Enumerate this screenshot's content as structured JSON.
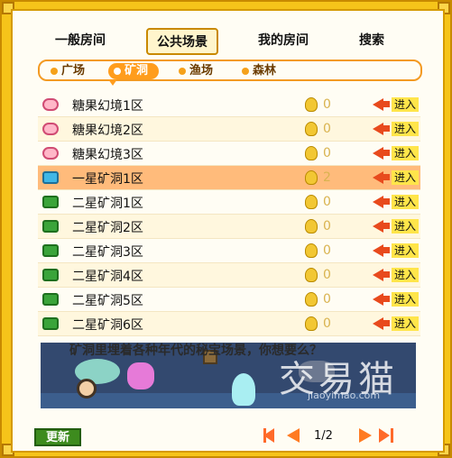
{
  "tabs": [
    {
      "label": "一般房间"
    },
    {
      "label": "公共场景",
      "active": true
    },
    {
      "label": "我的房间"
    },
    {
      "label": "搜索"
    }
  ],
  "subtabs": [
    {
      "label": "广场"
    },
    {
      "label": "矿洞",
      "active": true
    },
    {
      "label": "渔场"
    },
    {
      "label": "森林"
    }
  ],
  "rooms": [
    {
      "icon": "candy-icon",
      "name": "糖果幻境1区",
      "count": "0"
    },
    {
      "icon": "candy-icon",
      "name": "糖果幻境2区",
      "count": "0"
    },
    {
      "icon": "candy-icon",
      "name": "糖果幻境3区",
      "count": "0"
    },
    {
      "icon": "ore-icon",
      "name": "一星矿洞1区",
      "count": "2",
      "selected": true
    },
    {
      "icon": "ore-icon",
      "name": "二星矿洞1区",
      "count": "0"
    },
    {
      "icon": "ore-icon",
      "name": "二星矿洞2区",
      "count": "0"
    },
    {
      "icon": "ore-icon",
      "name": "二星矿洞3区",
      "count": "0"
    },
    {
      "icon": "ore-icon",
      "name": "二星矿洞4区",
      "count": "0"
    },
    {
      "icon": "ore-icon",
      "name": "二星矿洞5区",
      "count": "0"
    },
    {
      "icon": "ore-icon",
      "name": "二星矿洞6区",
      "count": "0"
    }
  ],
  "enter_label": "进入",
  "banner": {
    "text": "矿洞里埋着各种年代的秘宝场景，你想要么？",
    "watermark": "交易猫",
    "watermark_url": "jiaoyimao.com"
  },
  "refresh_label": "更新",
  "pager": {
    "label": "1/2"
  },
  "colors": {
    "frame": "#f6c41a",
    "accent": "#ff9d1d",
    "selected_row": "#ffbb7b"
  }
}
